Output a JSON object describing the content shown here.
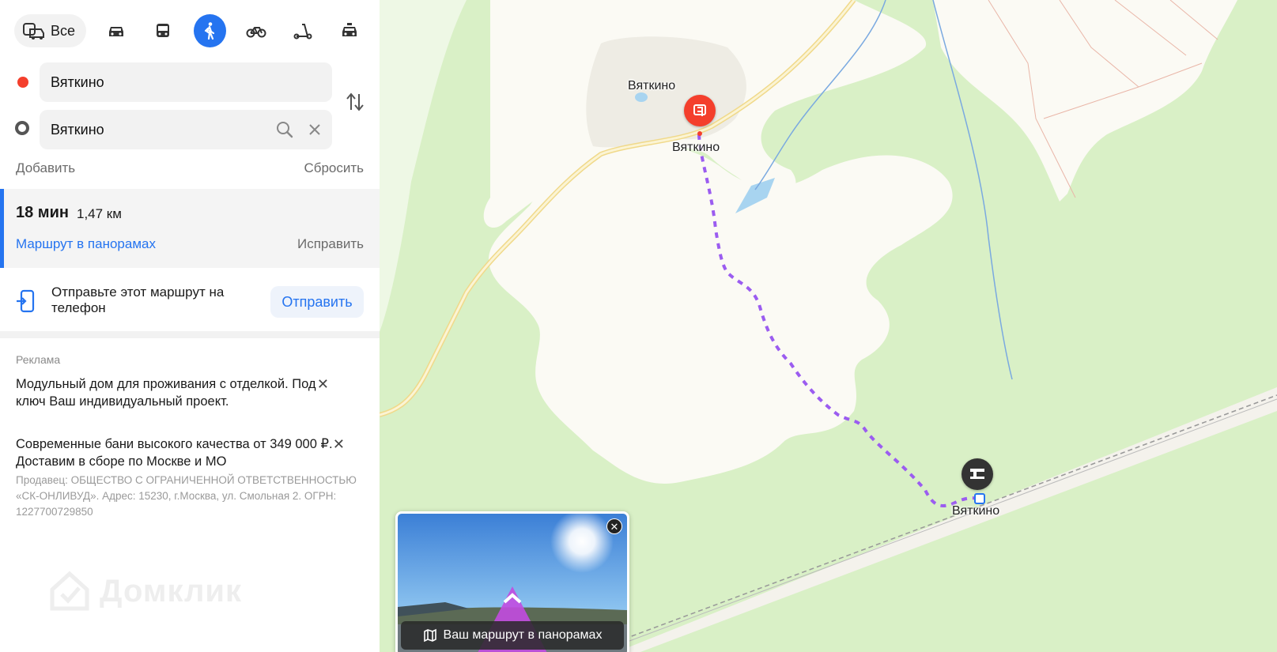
{
  "transport_modes": {
    "all_label": "Все",
    "modes": [
      {
        "name": "car-icon"
      },
      {
        "name": "bus-icon"
      },
      {
        "name": "walk-icon",
        "active": true
      },
      {
        "name": "bicycle-icon"
      },
      {
        "name": "scooter-icon"
      },
      {
        "name": "taxi-icon"
      }
    ],
    "active_color": "#2574f0"
  },
  "route_form": {
    "from_value": "Вяткино",
    "to_value": "Вяткино",
    "add_label": "Добавить",
    "reset_label": "Сбросить"
  },
  "route_summary": {
    "time": "18 мин",
    "distance": "1,47 км",
    "panorama_link": "Маршрут в панорамах",
    "fix_link": "Исправить"
  },
  "send_to_phone": {
    "text": "Отправьте этот маршрут на телефон",
    "button": "Отправить"
  },
  "ads": {
    "label": "Реклама",
    "items": [
      {
        "text": "Модульный дом для проживания с отделкой. Под ключ Ваш индивидуальный проект."
      },
      {
        "text": "Современные бани высокого качества от 349 000 ₽. Доставим в сборе по Москве и МО"
      }
    ],
    "seller": "Продавец: ОБЩЕСТВО С ОГРАНИЧЕННОЙ ОТВЕТСТВЕННОСТЬЮ «СК-ОНЛИВУД». Адрес: 15230, г.Москва, ул. Смольная 2. ОГРН: 1227700729850",
    "watermark": "Домклик"
  },
  "map": {
    "labels": {
      "village": "Вяткино",
      "start_stop": "Вяткино",
      "end_stop": "Вяткино"
    },
    "route_color": "#9b5cf0",
    "start_pin_color": "#f43f2c",
    "end_pin_color": "#333333"
  },
  "panorama_preview": {
    "caption": "Ваш маршрут в панорамах"
  }
}
